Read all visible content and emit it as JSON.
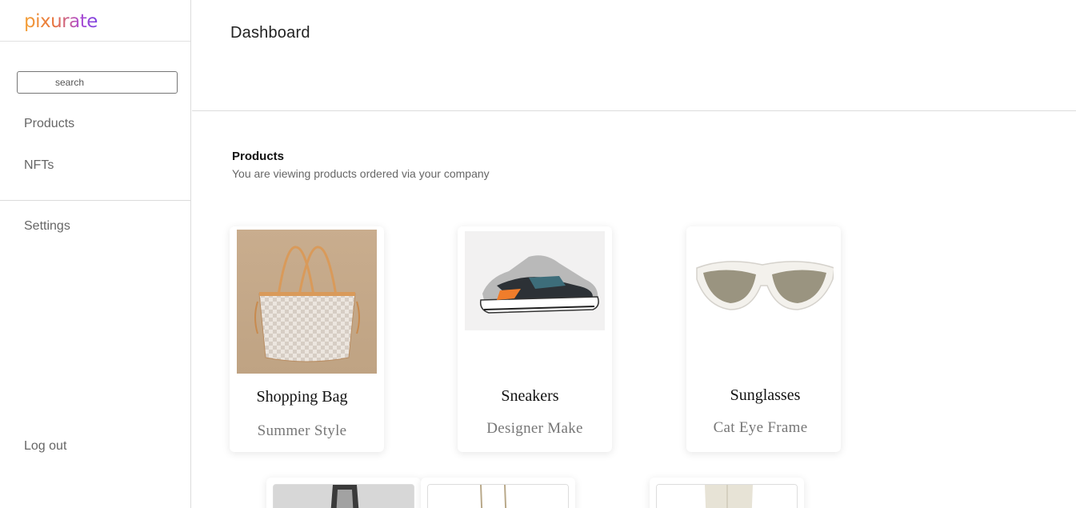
{
  "app": {
    "logo_text": "pixurate"
  },
  "sidebar": {
    "search_placeholder": "search",
    "items": [
      {
        "label": "Products"
      },
      {
        "label": "NFTs"
      },
      {
        "label": "Settings"
      }
    ],
    "logout_label": "Log out"
  },
  "header": {
    "title": "Dashboard"
  },
  "section": {
    "title": "Products",
    "subtitle": "You are viewing products ordered via your company"
  },
  "products": [
    {
      "name": "Shopping Bag",
      "subtitle": "Summer Style",
      "icon": "shopping-bag-image"
    },
    {
      "name": "Sneakers",
      "subtitle": "Designer Make",
      "icon": "sneakers-image"
    },
    {
      "name": "Sunglasses",
      "subtitle": "Cat Eye Frame",
      "icon": "sunglasses-image"
    }
  ],
  "colors": {
    "logo_gradient_start": "#f4a23a",
    "logo_gradient_end": "#7a3fe0",
    "text_muted": "#666666"
  }
}
